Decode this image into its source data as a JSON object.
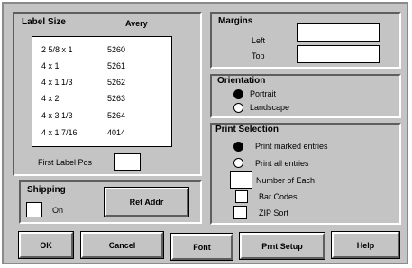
{
  "label_size": {
    "title": "Label Size",
    "avery_header": "Avery",
    "items": [
      {
        "size": "2 5/8 x 1",
        "code": "5260"
      },
      {
        "size": "4 x 1",
        "code": "5261"
      },
      {
        "size": "4 x 1 1/3",
        "code": "5262"
      },
      {
        "size": "4 x 2",
        "code": "5263"
      },
      {
        "size": "4 x 3 1/3",
        "code": "5264"
      },
      {
        "size": "4 x 1 7/16",
        "code": "4014"
      }
    ],
    "first_label_pos_label": "First Label Pos",
    "first_label_pos_value": ""
  },
  "margins": {
    "title": "Margins",
    "left_label": "Left",
    "left_value": "",
    "top_label": "Top",
    "top_value": ""
  },
  "orientation": {
    "title": "Orientation",
    "portrait_label": "Portrait",
    "landscape_label": "Landscape",
    "selected": "portrait"
  },
  "print_selection": {
    "title": "Print Selection",
    "marked_label": "Print marked entries",
    "all_label": "Print all entries",
    "number_each_label": "Number of Each",
    "number_each_value": "",
    "bar_codes_label": "Bar Codes",
    "zip_sort_label": "ZIP Sort",
    "selected": "marked"
  },
  "shipping": {
    "title": "Shipping",
    "on_label": "On",
    "ret_addr_label": "Ret Addr"
  },
  "buttons": {
    "ok": "OK",
    "cancel": "Cancel",
    "font": "Font",
    "print_setup": "Prnt Setup",
    "help": "Help"
  },
  "colors": {
    "dialog_bg": "#c4c4c4",
    "field_bg": "#ffffff",
    "shadow": "#5e5e5e"
  }
}
